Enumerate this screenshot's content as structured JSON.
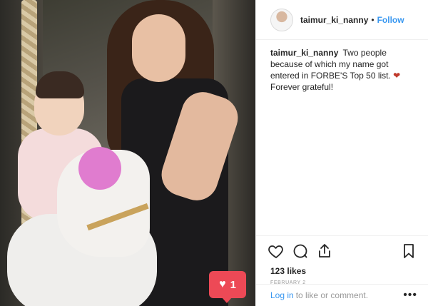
{
  "post": {
    "username": "taimur_ki_nanny",
    "follow_label": "Follow",
    "separator": "•",
    "caption_text": "Two people because of which my name got entered in FORBE'S Top 50 list.",
    "caption_heart": "❤",
    "caption_line2": "Forever grateful!",
    "likes": "123 likes",
    "date": "FEBRUARY 2",
    "login_label": "Log in",
    "login_suffix": "to like or comment.",
    "more_label": "•••"
  },
  "badge": {
    "count": "1",
    "color": "#ed4956"
  },
  "icons": [
    "heart-icon",
    "comment-icon",
    "share-icon",
    "bookmark-icon"
  ],
  "colors": {
    "link": "#3897f0",
    "text": "#262626",
    "muted": "#999999"
  }
}
